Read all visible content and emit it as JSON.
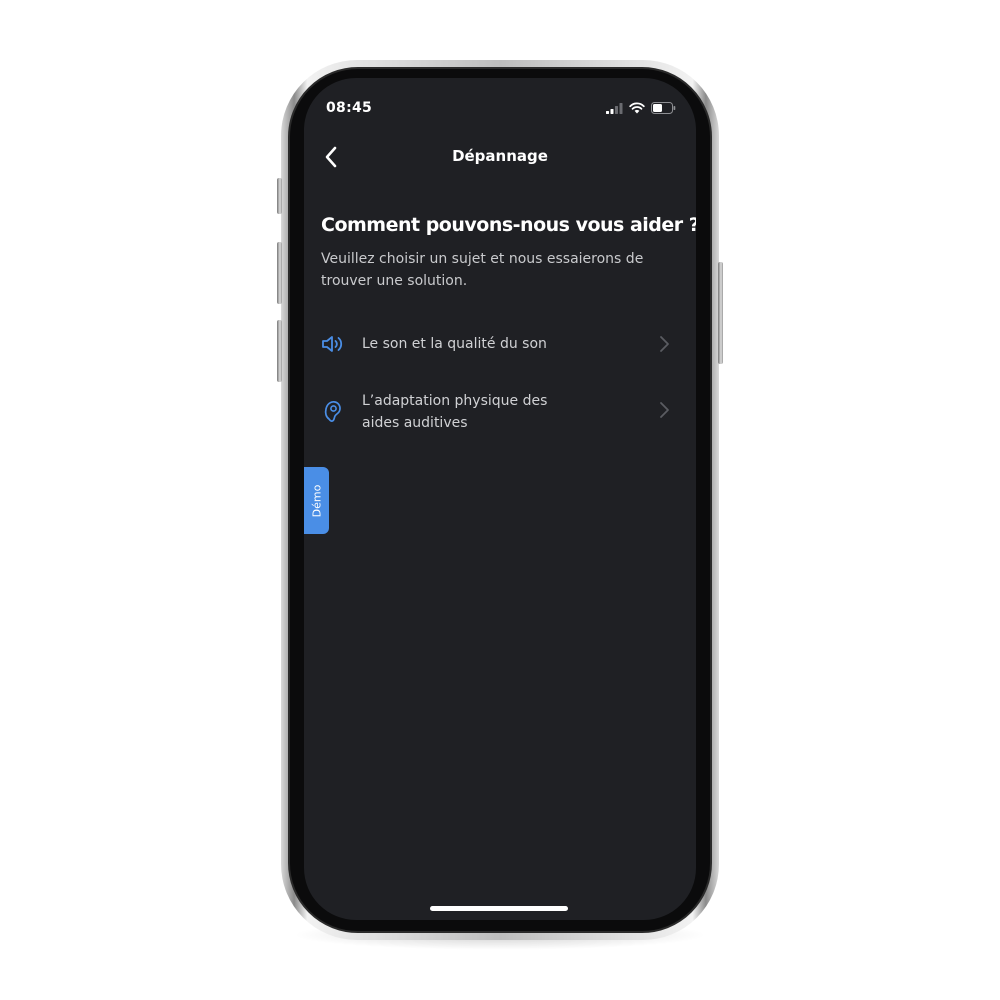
{
  "status_bar": {
    "time": "08:45",
    "icons": [
      "cellular-signal-icon",
      "wifi-icon",
      "battery-icon"
    ]
  },
  "nav": {
    "back_icon": "chevron-left-icon",
    "title": "Dépannage"
  },
  "main": {
    "heading": "Comment pouvons-nous vous aider ?",
    "subtitle": "Veuillez choisir un sujet et nous essaierons de trouver une solution.",
    "topics": [
      {
        "icon": "speaker-sound-icon",
        "label": "Le son et la qualité du son"
      },
      {
        "icon": "hearing-aid-icon",
        "label_line1": "L’adaptation physique des",
        "label_line2": "aides auditives"
      }
    ]
  },
  "demo_tab": {
    "label": "Démo"
  },
  "colors": {
    "background": "#1f2024",
    "accent": "#4a8ee6",
    "text_primary": "#ffffff",
    "text_secondary": "#c9cacd",
    "chevron": "#5a5c62"
  }
}
